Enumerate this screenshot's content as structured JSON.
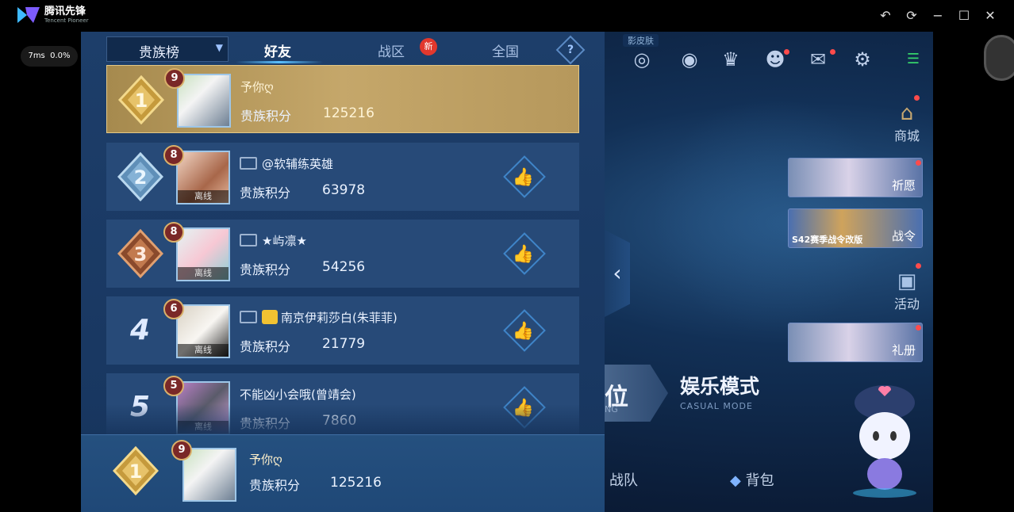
{
  "window": {
    "app_name": "腾讯先锋",
    "app_name_en": "Tencent Pioneer",
    "ping": "7ms",
    "loss": "0.0%"
  },
  "tabs": {
    "dropdown": "贵族榜",
    "items": [
      {
        "label": "好友",
        "active": true
      },
      {
        "label": "战区",
        "active": false
      },
      {
        "label": "全国",
        "active": false
      }
    ],
    "new_badge": "新",
    "help": "?"
  },
  "score_label": "贵族积分",
  "offline": "离线",
  "rows": [
    {
      "rank": "1",
      "level": "9",
      "name": "予你ღ",
      "score": "125216"
    },
    {
      "rank": "2",
      "level": "8",
      "name": "@软辅练英雄",
      "score": "63978"
    },
    {
      "rank": "3",
      "level": "8",
      "name": "★屿凛★",
      "score": "54256"
    },
    {
      "rank": "4",
      "level": "6",
      "name": "南京伊莉莎白(朱菲菲)",
      "score": "21779"
    },
    {
      "rank": "5",
      "level": "5",
      "name": "不能凶小会哦(曾靖会)",
      "score": "7860"
    }
  ],
  "my_row": {
    "rank": "1",
    "level": "9",
    "name": "予你ღ",
    "score": "125216"
  },
  "game": {
    "skin_label": "影皮肤",
    "shop": "商城",
    "wish": "祈愿",
    "battle_pass": "战令",
    "battle_pass_banner": "S42赛季战令改版",
    "activity": "活动",
    "gift": "礼册",
    "mode_left": "位",
    "mode_left_en": "NG",
    "mode_right": "娱乐模式",
    "mode_right_en": "CASUAL MODE",
    "team": "战队",
    "bag": "背包"
  },
  "colors": {
    "panel": "#1d3e6a",
    "row": "#274a78",
    "first_row": "#c5a76a",
    "like": "#4aa7ff",
    "new_badge": "#e2382d"
  }
}
